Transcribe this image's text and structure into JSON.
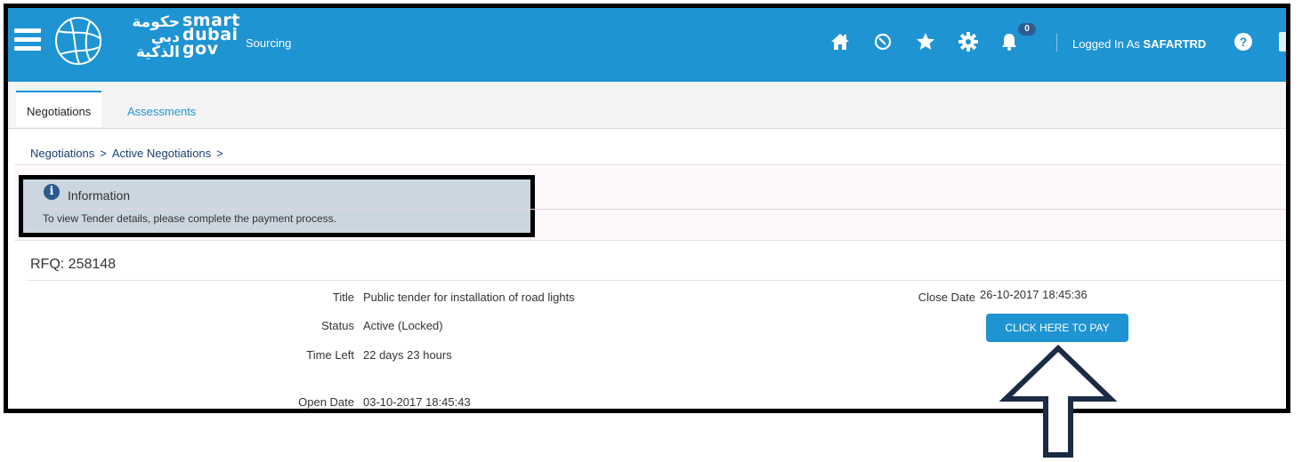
{
  "header": {
    "logo_arabic": "حكومة دبي الذكية",
    "logo_latin_1": "smart",
    "logo_latin_2": "dubai",
    "logo_latin_3": "gov",
    "app_title": "Sourcing",
    "icons": [
      "home-icon",
      "history-icon",
      "star-icon",
      "gear-icon",
      "bell-icon",
      "help-icon",
      "logout-icon"
    ],
    "notification_count": "0",
    "logged_in_prefix": "Logged In As",
    "logged_in_user": "SAFARTRD",
    "help_label": "?"
  },
  "tabs": [
    {
      "label": "Negotiations",
      "active": true
    },
    {
      "label": "Assessments",
      "active": false
    }
  ],
  "breadcrumb": {
    "items": [
      "Negotiations",
      "Active Negotiations"
    ],
    "separator": ">"
  },
  "info": {
    "icon_glyph": "i",
    "title": "Information",
    "message": "To view Tender details, please complete the payment process."
  },
  "rfq": {
    "heading": "RFQ: 258148",
    "fields": [
      {
        "label": "Title",
        "value": "Public tender for installation of road lights"
      },
      {
        "label": "Status",
        "value": "Active (Locked)"
      },
      {
        "label": "Time Left",
        "value": "22 days 23 hours"
      },
      {
        "label": "Open Date",
        "value": "03-10-2017 18:45:43"
      }
    ],
    "close_date_label": "Close Date",
    "close_date_value": "26-10-2017 18:45:36",
    "pay_button": "CLICK HERE TO PAY"
  },
  "colors": {
    "brand_blue": "#1e94d3",
    "info_bg": "#ccd6e0",
    "arrow_stroke": "#1b2b45"
  }
}
